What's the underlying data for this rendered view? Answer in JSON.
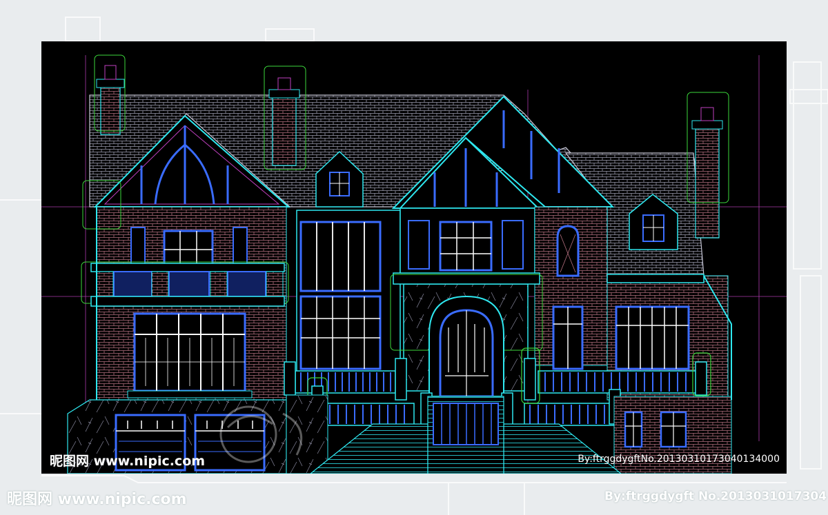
{
  "drawing": {
    "title": "",
    "background": "#000000",
    "colors": {
      "outline": "#2ee8f0",
      "brick": "#c98a9a",
      "roof": "#a7a7b6",
      "window": "#3a6cff",
      "glass": "#ffffff",
      "layer_green": "#3bd83b",
      "layer_magenta": "#c040c0",
      "stucco": "#8a8aa0"
    }
  },
  "watermark": {
    "site_cn": "昵图网",
    "site_url": "www.nipic.com",
    "author": "By:ftrggdygft",
    "number": "No.20130310173040134000",
    "outer_author_number": "By:ftrggdygft No.2013031017304"
  }
}
